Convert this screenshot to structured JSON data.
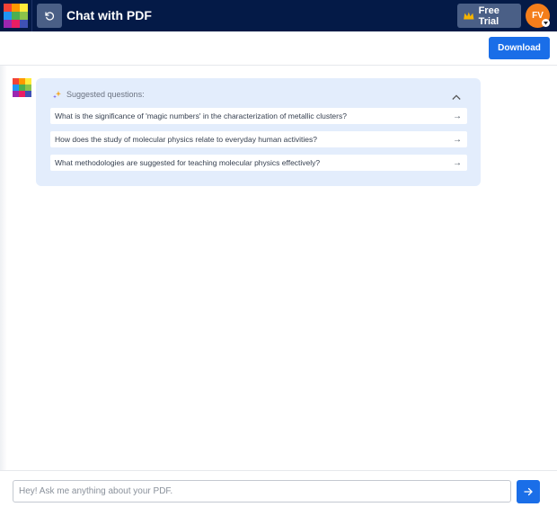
{
  "header": {
    "title": "Chat with PDF",
    "free_trial_label": "Free Trial",
    "avatar_initials": "FV"
  },
  "toolbar": {
    "download_label": "Download"
  },
  "suggestions": {
    "title": "Suggested questions:",
    "questions": [
      "What is the significance of 'magic numbers' in the characterization of metallic clusters?",
      "How does the study of molecular physics relate to everyday human activities?",
      "What methodologies are suggested for teaching molecular physics effectively?"
    ]
  },
  "chat": {
    "placeholder": "Hey! Ask me anything about your PDF."
  },
  "colors": {
    "header_bg": "#041a47",
    "accent": "#1a6ee8",
    "card_bg": "#e3edfc",
    "avatar_bg": "#f47e1b"
  },
  "icons": {
    "logo": "app-logo-grid",
    "back": "rotate-ccw-icon",
    "trial": "crown-icon",
    "sparkle": "sparkle-icon",
    "collapse": "chevron-up-icon",
    "arrow": "arrow-right-icon",
    "send": "arrow-right-icon"
  }
}
